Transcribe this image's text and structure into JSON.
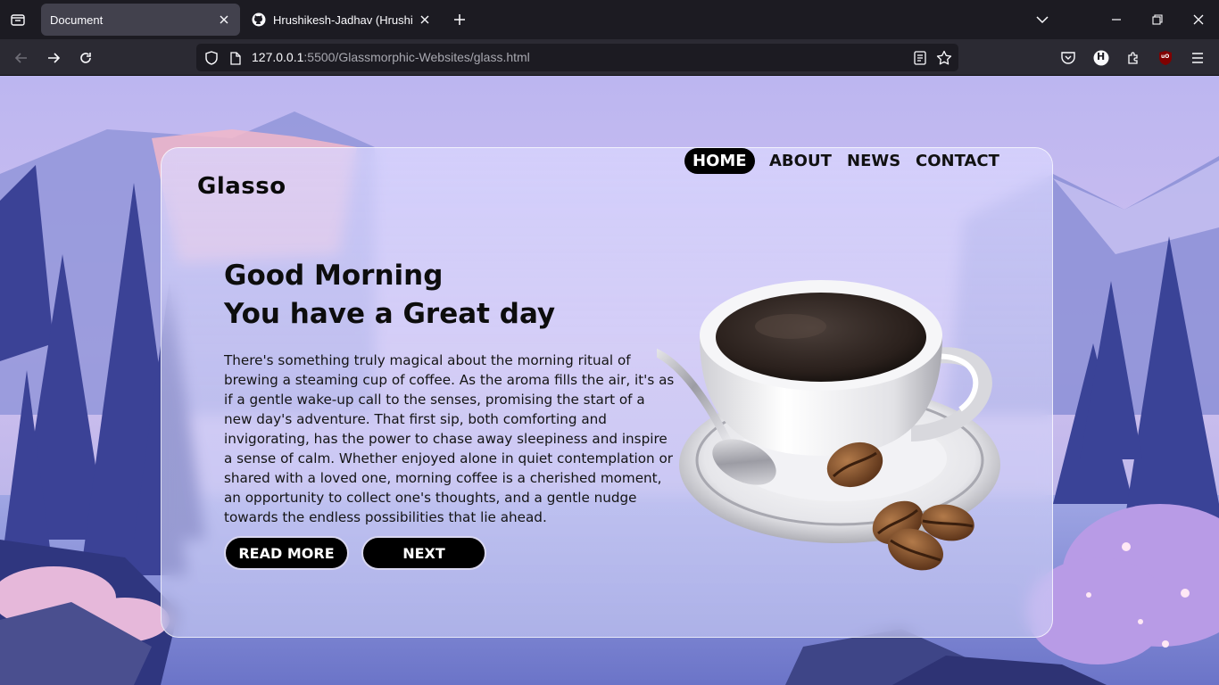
{
  "browser": {
    "tabs": [
      {
        "title": "Document",
        "active": true
      },
      {
        "title": "Hrushikesh-Jadhav (Hrushikesh",
        "active": false
      }
    ],
    "url_host": "127.0.0.1",
    "url_path": ":5500/Glassmorphic-Websites/glass.html",
    "profile_initial": "H",
    "ublock_label": "uO",
    "icons": [
      "tab-list-icon",
      "close-icon",
      "github-icon",
      "plus-icon",
      "chevron-down-icon",
      "minimize-icon",
      "restore-icon",
      "window-close-icon",
      "back-arrow-icon",
      "forward-arrow-icon",
      "reload-icon",
      "shield-icon",
      "page-icon",
      "reader-view-icon",
      "star-icon",
      "pocket-icon",
      "extensions-icon",
      "ublock-icon",
      "menu-icon"
    ]
  },
  "site": {
    "logo": "Glasso",
    "nav": [
      "HOME",
      "ABOUT",
      "NEWS",
      "CONTACT"
    ],
    "active_nav": "HOME",
    "heading_line1": "Good Morning",
    "heading_line2": "You have a Great day",
    "paragraph": "There's something truly magical about the morning ritual of brewing a steaming cup of coffee. As the aroma fills the air, it's as if a gentle wake-up call to the senses, promising the start of a new day's adventure. That first sip, both comforting and invigorating, has the power to chase away sleepiness and inspire a sense of calm. Whether enjoyed alone in quiet contemplation or shared with a loved one, morning coffee is a cherished moment, an opportunity to collect one's thoughts, and a gentle nudge towards the endless possibilities that lie ahead.",
    "buttons": {
      "read_more": "READ MORE",
      "next": "NEXT"
    }
  },
  "colors": {
    "browser_bg": "#1c1b22",
    "toolbar_bg": "#2b2a33",
    "active_tab": "#42414d",
    "button_bg": "#000000",
    "text": "#0d0d0d"
  }
}
